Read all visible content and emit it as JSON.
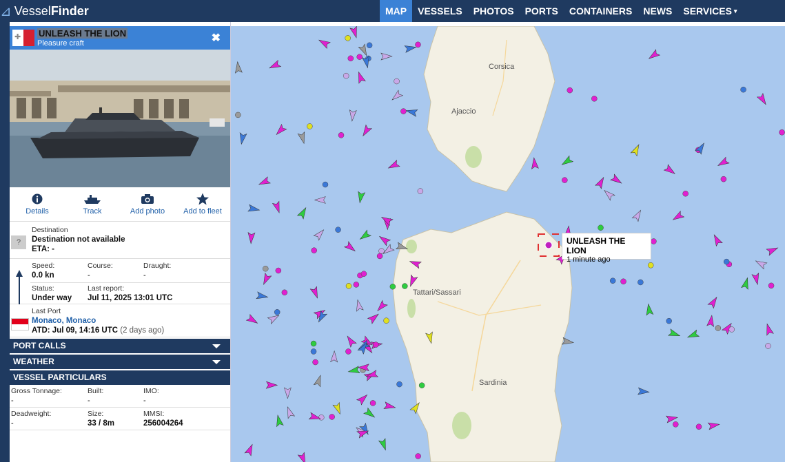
{
  "app": {
    "logo_prefix": "Vessel",
    "logo_suffix": "Finder"
  },
  "nav": {
    "map": "MAP",
    "vessels": "VESSELS",
    "photos": "PHOTOS",
    "ports": "PORTS",
    "containers": "CONTAINERS",
    "news": "NEWS",
    "services": "SERVICES",
    "services_caret": "▾"
  },
  "vessel": {
    "name": "UNLEASH THE LION",
    "type": "Pleasure craft",
    "close": "✖",
    "flag": "malta-flag"
  },
  "actions": {
    "details": "Details",
    "track": "Track",
    "add_photo": "Add photo",
    "add_fleet": "Add to fleet"
  },
  "destination": {
    "label": "Destination",
    "value": "Destination not available",
    "eta": "ETA: -",
    "icon": "?"
  },
  "speed": {
    "label": "Speed:",
    "value": "0.0 kn"
  },
  "course": {
    "label": "Course:",
    "value": "-"
  },
  "draught": {
    "label": "Draught:",
    "value": "-"
  },
  "status": {
    "label": "Status:",
    "value": "Under way"
  },
  "last_report": {
    "label": "Last report:",
    "value": "Jul 11, 2025 13:01 UTC"
  },
  "last_port": {
    "label": "Last Port",
    "value": "Monaco, Monaco",
    "atd": "ATD: Jul 09, 14:16 UTC",
    "atd_ago": "(2 days ago)"
  },
  "sections": {
    "port_calls": "PORT CALLS",
    "weather": "WEATHER",
    "particulars": "VESSEL PARTICULARS"
  },
  "particulars": {
    "gross_tonnage": {
      "label": "Gross Tonnage:",
      "value": "-"
    },
    "built": {
      "label": "Built:",
      "value": "-"
    },
    "imo": {
      "label": "IMO:",
      "value": "-"
    },
    "deadweight": {
      "label": "Deadweight:",
      "value": "-"
    },
    "size": {
      "label": "Size:",
      "value": "33 / 8m"
    },
    "mmsi": {
      "label": "MMSI:",
      "value": "256004264"
    }
  },
  "map": {
    "labels": {
      "corsica": "Corsica",
      "ajaccio": "Ajaccio",
      "sassari": "Tattari/Sassari",
      "sardinia": "Sardinia"
    },
    "tooltip": {
      "name": "UNLEASH THE LION",
      "time": "1 minute ago"
    }
  },
  "colors": {
    "nav_bg": "#1f3a60",
    "accent": "#3b82d6",
    "sea": "#a9c8ee",
    "land": "#f3f0e4",
    "pleasure": "#e020d0",
    "cargo": "#2ecc40",
    "tanker": "#e0e020",
    "passenger": "#3a78d8"
  }
}
